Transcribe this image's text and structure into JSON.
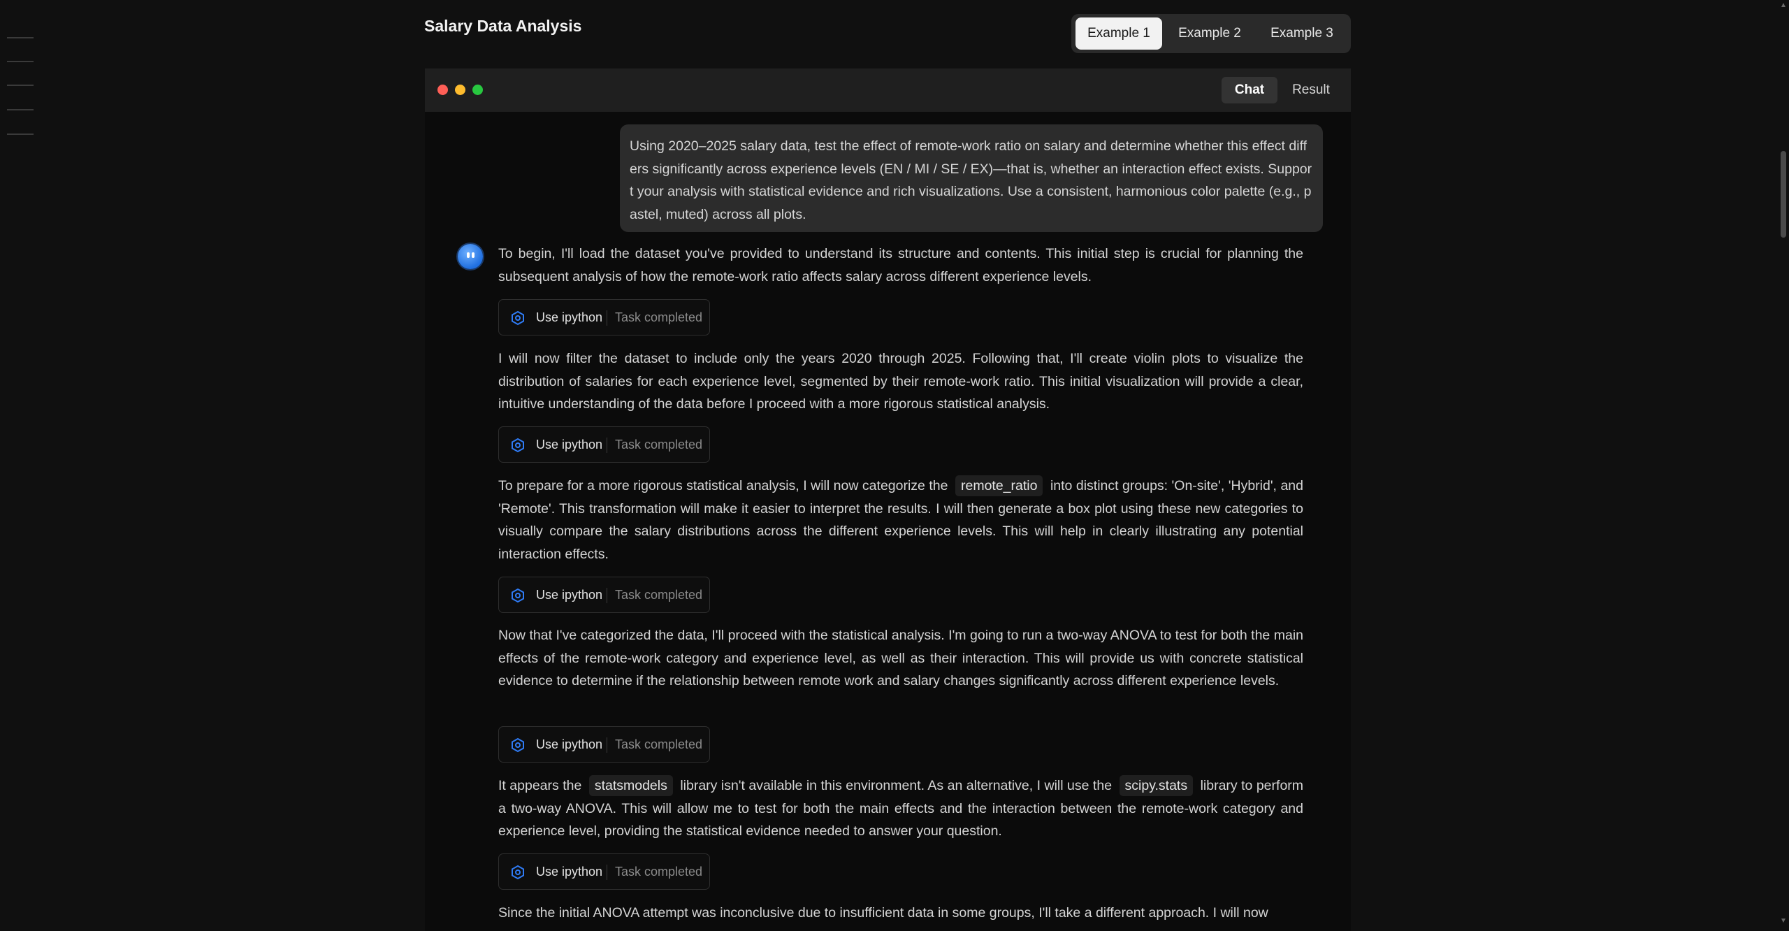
{
  "page": {
    "title": "Salary Data Analysis"
  },
  "example_tabs": [
    {
      "label": "Example 1",
      "active": true
    },
    {
      "label": "Example 2",
      "active": false
    },
    {
      "label": "Example 3",
      "active": false
    }
  ],
  "window": {
    "traffic_lights": [
      "#ff5f57",
      "#febc2e",
      "#28c840"
    ],
    "view_tabs": [
      {
        "label": "Chat",
        "active": true
      },
      {
        "label": "Result",
        "active": false
      }
    ]
  },
  "chat": {
    "user_message": "Using 2020–2025 salary data, test the effect of remote-work ratio on salary and determine whether this effect differs significantly across experience levels (EN / MI / SE / EX)—that is, whether an interaction effect exists. Support your analysis with statistical evidence and rich visualizations. Use a consistent, harmonious color palette (e.g., pastel, muted) across all plots.",
    "assistant": {
      "messages": [
        "To begin, I'll load the dataset you've provided to understand its structure and contents. This initial step is crucial for planning the subsequent analysis of how the remote-work ratio affects salary across different experience levels.",
        "I will now filter the dataset to include only the years 2020 through 2025. Following that, I'll create violin plots to visualize the distribution of salaries for each experience level, segmented by their remote-work ratio. This initial visualization will provide a clear, intuitive understanding of the data before I proceed with a more rigorous statistical analysis.",
        {
          "before": "To prepare for a more rigorous statistical analysis, I will now categorize the",
          "code": "remote_ratio",
          "after": "into distinct groups: 'On-site', 'Hybrid', and 'Remote'. This transformation will make it easier to interpret the results. I will then generate a box plot using these new categories to visually compare the salary distributions across the different experience levels. This will help in clearly illustrating any potential interaction effects."
        },
        "Now that I've categorized the data, I'll proceed with the statistical analysis. I'm going to run a two-way ANOVA to test for both the main effects of the remote-work category and experience level, as well as their interaction. This will provide us with concrete statistical evidence to determine if the relationship between remote work and salary changes significantly across different experience levels.",
        {
          "before": "It appears the",
          "code": "statsmodels",
          "middle": "library isn't available in this environment. As an alternative, I will use the",
          "code2": "scipy.stats",
          "after": "library to perform a two-way ANOVA. This will allow me to test for both the main effects and the interaction between the remote-work category and experience level, providing the statistical evidence needed to answer your question."
        },
        "Since the initial ANOVA attempt was inconclusive due to insufficient data in some groups, I'll take a different approach. I will now"
      ],
      "tool_calls": [
        {
          "tool": "Use ipython",
          "status": "Task completed"
        },
        {
          "tool": "Use ipython",
          "status": "Task completed"
        },
        {
          "tool": "Use ipython",
          "status": "Task completed"
        },
        {
          "tool": "Use ipython",
          "status": "Task completed"
        },
        {
          "tool": "Use ipython",
          "status": "Task completed"
        }
      ]
    }
  },
  "colors": {
    "background": "#101010",
    "accent": "#2f7bf5",
    "bubble": "#2c2c2c"
  }
}
